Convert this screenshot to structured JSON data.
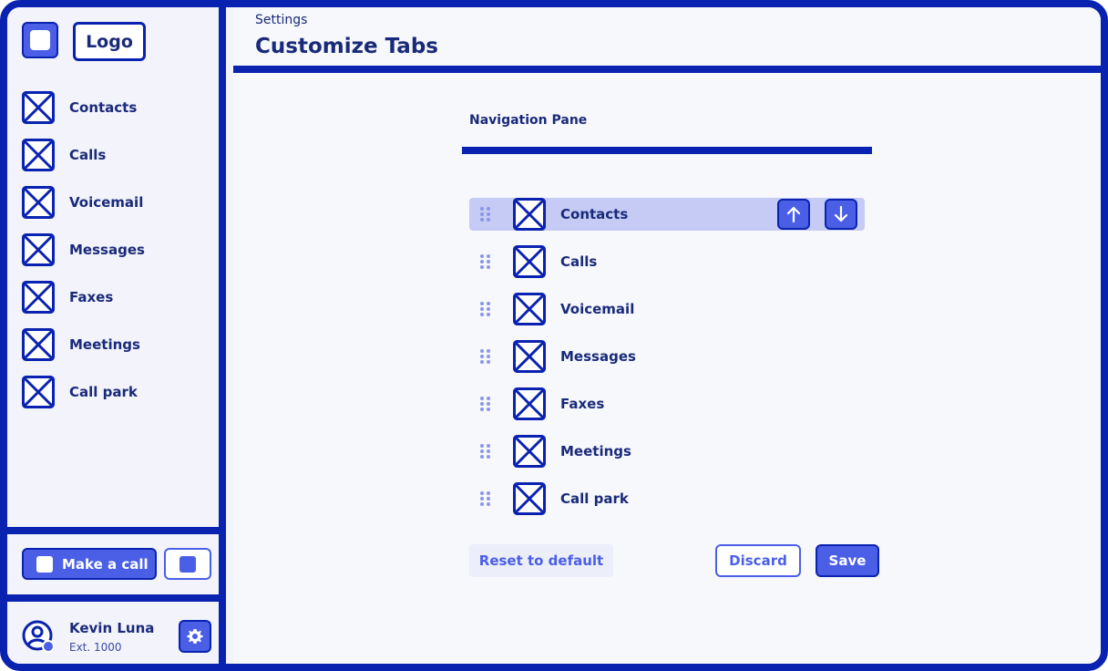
{
  "sidebar": {
    "logo_text": "Logo",
    "items": [
      {
        "label": "Contacts",
        "icon": "placeholder-x-icon"
      },
      {
        "label": "Calls",
        "icon": "placeholder-x-icon"
      },
      {
        "label": "Voicemail",
        "icon": "placeholder-x-icon"
      },
      {
        "label": "Messages",
        "icon": "placeholder-x-icon"
      },
      {
        "label": "Faxes",
        "icon": "placeholder-x-icon"
      },
      {
        "label": "Meetings",
        "icon": "placeholder-x-icon"
      },
      {
        "label": "Call park",
        "icon": "placeholder-x-icon"
      }
    ],
    "call_button_label": "Make a call",
    "user": {
      "name": "Kevin Luna",
      "ext": "Ext. 1000"
    }
  },
  "header": {
    "breadcrumb": "Settings",
    "title": "Customize Tabs"
  },
  "main": {
    "section_title": "Navigation Pane",
    "tabs": [
      {
        "label": "Contacts",
        "selected": true
      },
      {
        "label": "Calls",
        "selected": false
      },
      {
        "label": "Voicemail",
        "selected": false
      },
      {
        "label": "Messages",
        "selected": false
      },
      {
        "label": "Faxes",
        "selected": false
      },
      {
        "label": "Meetings",
        "selected": false
      },
      {
        "label": "Call park",
        "selected": false
      }
    ],
    "reset_label": "Reset to default",
    "discard_label": "Discard",
    "save_label": "Save"
  },
  "colors": {
    "primary": "#0a22b0",
    "accent": "#4a5fe6",
    "selected_row": "#c5cbf5",
    "background": "#f2f3fb"
  }
}
